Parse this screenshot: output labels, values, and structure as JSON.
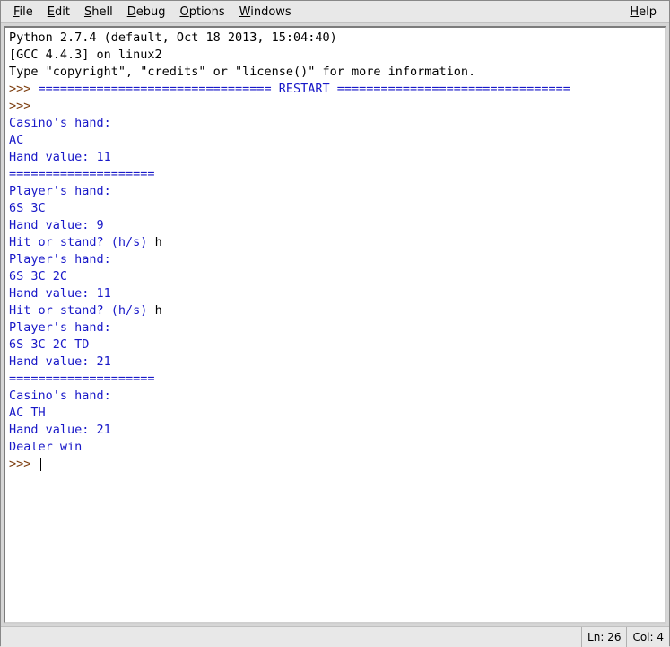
{
  "menu": {
    "file": "File",
    "edit": "Edit",
    "shell": "Shell",
    "debug": "Debug",
    "options": "Options",
    "windows": "Windows",
    "help": "Help"
  },
  "header": {
    "line1": "Python 2.7.4 (default, Oct 18 2013, 15:04:40)",
    "line2": "[GCC 4.4.3] on linux2",
    "line3": "Type \"copyright\", \"credits\" or \"license()\" for more information."
  },
  "restart": {
    "prompt": ">>> ",
    "banner": "================================ RESTART ================================"
  },
  "lines": [
    {
      "prompt": ">>> "
    },
    {
      "out": "Casino's hand:"
    },
    {
      "out": "AC"
    },
    {
      "out": "Hand value: 11"
    },
    {
      "out": "===================="
    },
    {
      "out": "Player's hand:"
    },
    {
      "out": "6S 3C"
    },
    {
      "out": "Hand value: 9"
    },
    {
      "out": "Hit or stand? (h/s) ",
      "in": "h"
    },
    {
      "out": "Player's hand:"
    },
    {
      "out": "6S 3C 2C"
    },
    {
      "out": "Hand value: 11"
    },
    {
      "out": "Hit or stand? (h/s) ",
      "in": "h"
    },
    {
      "out": "Player's hand:"
    },
    {
      "out": "6S 3C 2C TD"
    },
    {
      "out": "Hand value: 21"
    },
    {
      "out": "===================="
    },
    {
      "out": "Casino's hand:"
    },
    {
      "out": "AC TH"
    },
    {
      "out": "Hand value: 21"
    },
    {
      "out": "Dealer win"
    }
  ],
  "finalPrompt": ">>> ",
  "status": {
    "line": "Ln: 26",
    "col": "Col: 4"
  }
}
